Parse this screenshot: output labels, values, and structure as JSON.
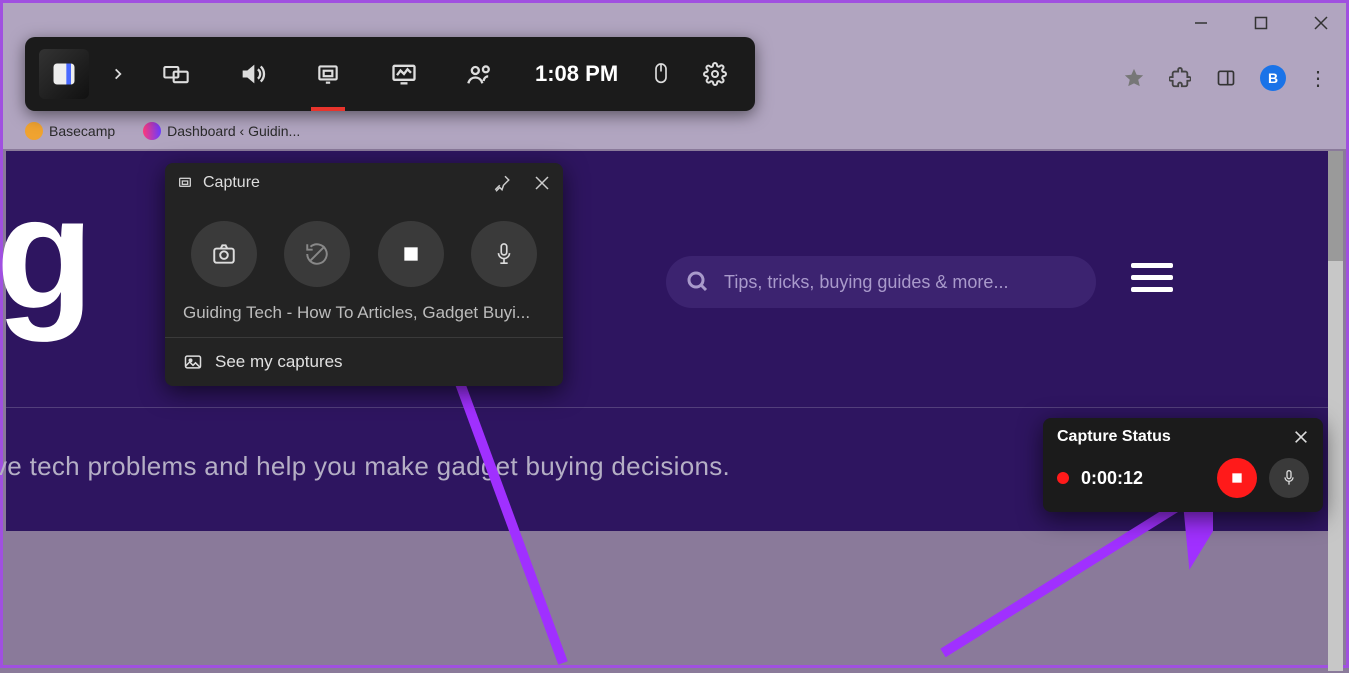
{
  "window": {
    "profile_letter": "B"
  },
  "bookmarks": {
    "items": [
      {
        "label": "Basecamp"
      },
      {
        "label": "Dashboard ‹ Guidin..."
      }
    ]
  },
  "page": {
    "logo_letter": "g",
    "search_placeholder": "Tips, tricks, buying guides & more...",
    "tagline": "ve tech problems and help you make gadget buying decisions."
  },
  "gamebar": {
    "time": "1:08 PM"
  },
  "capture_widget": {
    "title": "Capture",
    "window_caption": "Guiding Tech - How To Articles, Gadget Buyi...",
    "footer_label": "See my captures"
  },
  "capture_status": {
    "title": "Capture Status",
    "elapsed": "0:00:12"
  }
}
